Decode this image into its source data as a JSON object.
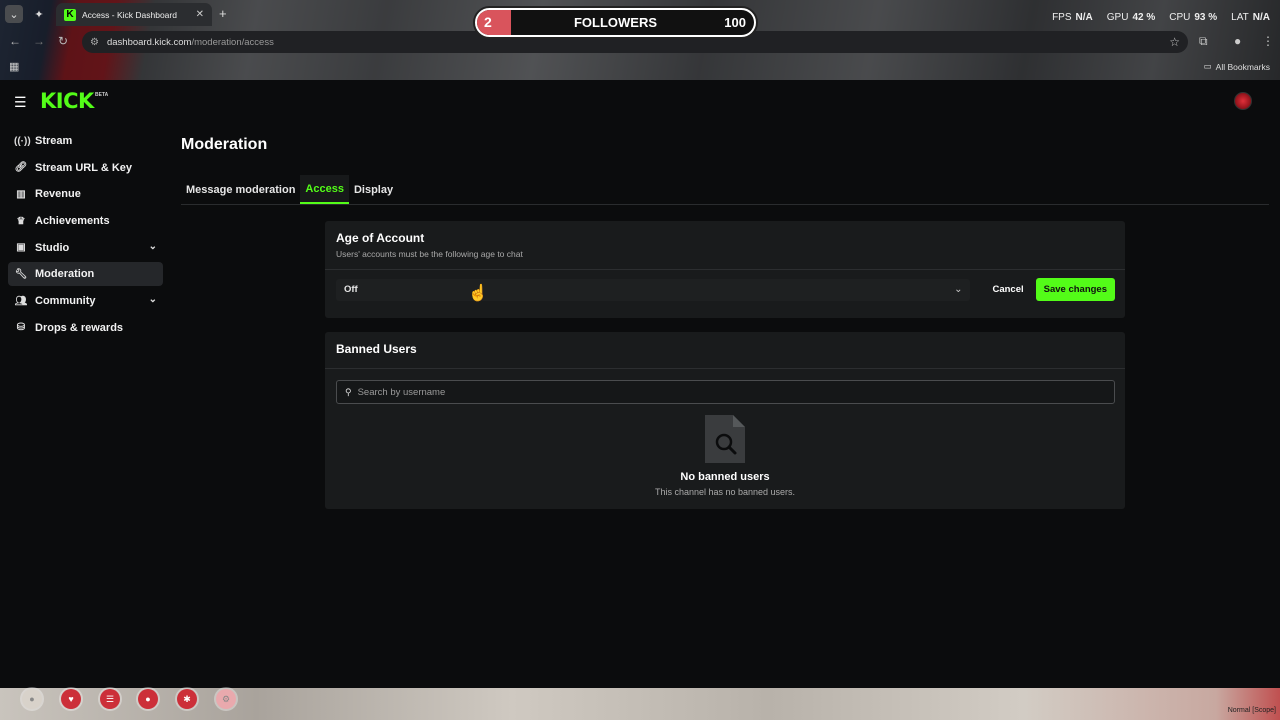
{
  "browser": {
    "tab_title": "Access - Kick Dashboard",
    "url_host": "dashboard.kick.com",
    "url_path": "/moderation/access",
    "bookmarks_label": "All Bookmarks"
  },
  "overlay": {
    "followers_count": "2",
    "followers_label": "FOLLOWERS",
    "followers_goal": "100",
    "followers_progress": 0.02,
    "perf": [
      {
        "label": "FPS",
        "value": "N/A"
      },
      {
        "label": "GPU",
        "value": "42 %"
      },
      {
        "label": "CPU",
        "value": "93 %"
      },
      {
        "label": "LAT",
        "value": "N/A"
      }
    ],
    "bottom_label": "Normal [Scope]"
  },
  "app": {
    "logo": "KICK",
    "logo_badge": "BETA"
  },
  "sidebar": {
    "items": [
      {
        "label": "Stream",
        "icon": "broadcast-icon"
      },
      {
        "label": "Stream URL & Key",
        "icon": "link-icon"
      },
      {
        "label": "Revenue",
        "icon": "chart-icon"
      },
      {
        "label": "Achievements",
        "icon": "trophy-icon"
      },
      {
        "label": "Studio",
        "icon": "studio-icon"
      },
      {
        "label": "Moderation",
        "icon": "wrench-icon"
      },
      {
        "label": "Community",
        "icon": "people-icon"
      },
      {
        "label": "Drops & rewards",
        "icon": "gift-icon"
      }
    ]
  },
  "page": {
    "title": "Moderation",
    "tabs": [
      {
        "label": "Message moderation"
      },
      {
        "label": "Access"
      },
      {
        "label": "Display"
      }
    ]
  },
  "age_card": {
    "title": "Age of Account",
    "subtitle": "Users' accounts must be the following age to chat",
    "select_value": "Off",
    "cancel_label": "Cancel",
    "save_label": "Save changes"
  },
  "banned_card": {
    "title": "Banned Users",
    "search_placeholder": "Search by username",
    "empty_title": "No banned users",
    "empty_subtitle": "This channel has no banned users."
  },
  "colors": {
    "accent": "#53fc18",
    "background": "#0b0c0d",
    "card": "#191b1c"
  }
}
